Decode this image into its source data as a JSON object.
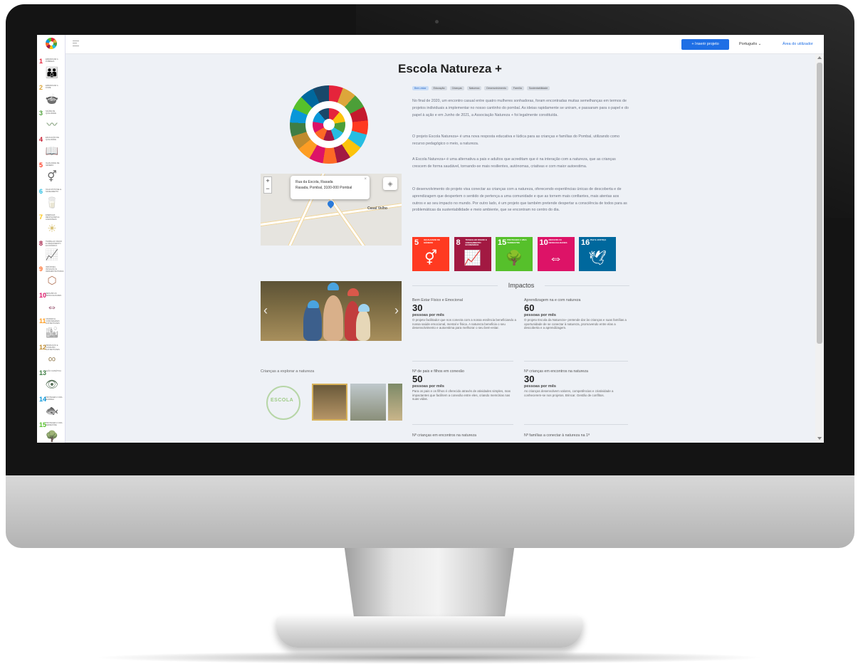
{
  "app": {
    "insert_button": "+ Inserir projeto",
    "language": "Português ⌄",
    "user_area": "Área do utilizador"
  },
  "sidebar": {
    "items": [
      {
        "num": "1",
        "label": "Erradicar a pobreza",
        "icon": "family-icon",
        "glyph": "👪",
        "color": "#e5243b"
      },
      {
        "num": "2",
        "label": "Erradicar a fome",
        "icon": "bowl-icon",
        "glyph": "🍲",
        "color": "#dda63a"
      },
      {
        "num": "3",
        "label": "Saúde de qualidade",
        "icon": "heartbeat-icon",
        "glyph": "〰",
        "color": "#4c9f38"
      },
      {
        "num": "4",
        "label": "Educação de qualidade",
        "icon": "book-icon",
        "glyph": "📖",
        "color": "#c5192d"
      },
      {
        "num": "5",
        "label": "Igualdade de género",
        "icon": "gender-icon",
        "glyph": "⚥",
        "color": "#ff3a21"
      },
      {
        "num": "6",
        "label": "Água potável e saneamento",
        "icon": "glass-icon",
        "glyph": "🥛",
        "color": "#26bde2"
      },
      {
        "num": "7",
        "label": "Energias renováveis e acessíveis",
        "icon": "sun-icon",
        "glyph": "☀",
        "color": "#fcc30b"
      },
      {
        "num": "8",
        "label": "Trabalho digno e crescimento económico",
        "icon": "growth-chart-icon",
        "glyph": "📈",
        "color": "#a21942"
      },
      {
        "num": "9",
        "label": "Indústria, inovação e infraestruturas",
        "icon": "cubes-icon",
        "glyph": "⬡",
        "color": "#fd6925"
      },
      {
        "num": "10",
        "label": "Reduzir as desigualdades",
        "icon": "equality-icon",
        "glyph": "⇔",
        "color": "#dd1367"
      },
      {
        "num": "11",
        "label": "Cidades e comunidades sustentáveis",
        "icon": "city-icon",
        "glyph": "🏙",
        "color": "#fd9d24"
      },
      {
        "num": "12",
        "label": "Produção e consumo sustentáveis",
        "icon": "infinity-icon",
        "glyph": "∞",
        "color": "#bf8b2e"
      },
      {
        "num": "13",
        "label": "Ação climática",
        "icon": "eye-globe-icon",
        "glyph": "👁",
        "color": "#3f7e44"
      },
      {
        "num": "14",
        "label": "Proteger a vida marinha",
        "icon": "fish-icon",
        "glyph": "🐟",
        "color": "#0a97d9"
      },
      {
        "num": "15",
        "label": "Proteger a vida terrestre",
        "icon": "tree-icon",
        "glyph": "🌳",
        "color": "#56c02b"
      }
    ]
  },
  "project": {
    "title": "Escola Natureza +",
    "tags": [
      "Bem-estar",
      "Educação",
      "Crianças",
      "Natureza",
      "Desenvolvimento",
      "Família",
      "Sustentabilidade"
    ],
    "paragraphs": [
      "No final de 2020, um encontro casual entre quatro mulheres sonhadoras, foram encontradas muitas semelhanças em termos de projetos individuais a implementar no nosso cantinho do pombal. As ideias rapidamente se uniram, e passaram para o papel e do papel à ação e em Junho de 2021, a Associação Natureza + foi legalmente constituída.",
      "O projeto Escola Natureza+ é uma nova resposta educativa e lúdica para as crianças e famílias do Pombal, utilizando como recurso pedagógico o meio, a natureza.",
      "A Escola Natureza+ é uma alternativa a pais e adultos que acreditam que é na interação com a natureza, que as crianças crescem de forma saudável, tornando-se mais resilientes, autónomas, criativas e com maior autoestima.",
      "O desenvolvimento do projeto visa conectar as crianças com a natureza, oferecendo experiências únicas de descoberta e de aprendizagem que despertem o sentido de pertença a uma comunidade e que as tornem mais confiantes, mais atentas aos outros e ao seu impacto no mundo. Por outro lado, é um projeto que também pretende despertar a consciência de todos para as problemáticas da sustentabilidade e meio ambiente, que se encontram no centro do dia."
    ]
  },
  "map": {
    "popup_line1": "Rua da Escola, Rasada",
    "popup_line2": "Rasada, Pombal, 3100-000 Pombal",
    "town_label": "Casal Velho",
    "zoom_in": "+",
    "zoom_out": "−"
  },
  "sdg_tiles": [
    {
      "num": "5",
      "label": "Igualdade de género",
      "glyph": "⚥",
      "color": "#ff3a21",
      "icon": "gender-icon"
    },
    {
      "num": "8",
      "label": "Trabalho digno e crescimento económico",
      "glyph": "📈",
      "color": "#a21942",
      "icon": "growth-chart-icon"
    },
    {
      "num": "15",
      "label": "Proteger a vida terrestre",
      "glyph": "🌳",
      "color": "#56c02b",
      "icon": "tree-icon"
    },
    {
      "num": "10",
      "label": "Reduzir as desigualdades",
      "glyph": "⇔",
      "color": "#dd1367",
      "icon": "equality-icon"
    },
    {
      "num": "16",
      "label": "Paz e justiça",
      "glyph": "🕊",
      "color": "#00689d",
      "icon": "dove-icon"
    }
  ],
  "impacts": {
    "title": "Impactos",
    "cards": [
      {
        "label": "Bem Estar Físico e Emocional",
        "value": "30",
        "unit": "pessoas por mês",
        "desc": "O projeto facilitador que nos conecta com a nossa essência beneficiando a nossa saúde emocional, mental e física. A natureza beneficia o seu desenvolvimento e autoestima para melhorar o seu bem-estar."
      },
      {
        "label": "Aprendizagem na e com natureza",
        "value": "60",
        "unit": "pessoas por mês",
        "desc": "O projeto Escola da Natureza+ pretende dar às crianças e suas famílias a oportunidade de se conectar à natureza, promovendo entre elas a descoberta e a aprendizagem."
      },
      {
        "label": "Nº de pais e filhos em conexão",
        "value": "50",
        "unit": "pessoas por mês",
        "desc": "Para os pais e os filhos é oferecido através de atividades simples, mas impactantes que facilitem a conexão entre eles, criando memórias nas suas vidas."
      },
      {
        "label": "Nº crianças em encontros na natureza",
        "value": "30",
        "unit": "pessoas por mês",
        "desc": "As crianças desenvolvem valores, competências e criatividade a conhecerem-se nos projetos. Brincar. Gestão de conflitos."
      },
      {
        "label": "Nº crianças em encontros na natureza",
        "value": "",
        "unit": "",
        "desc": ""
      },
      {
        "label": "Nº famílias a conectar à natureza na 1ª",
        "value": "",
        "unit": "",
        "desc": ""
      }
    ]
  },
  "gallery": {
    "caption": "Crianças a explorar a natureza",
    "logo_text": "ESCOLA"
  }
}
